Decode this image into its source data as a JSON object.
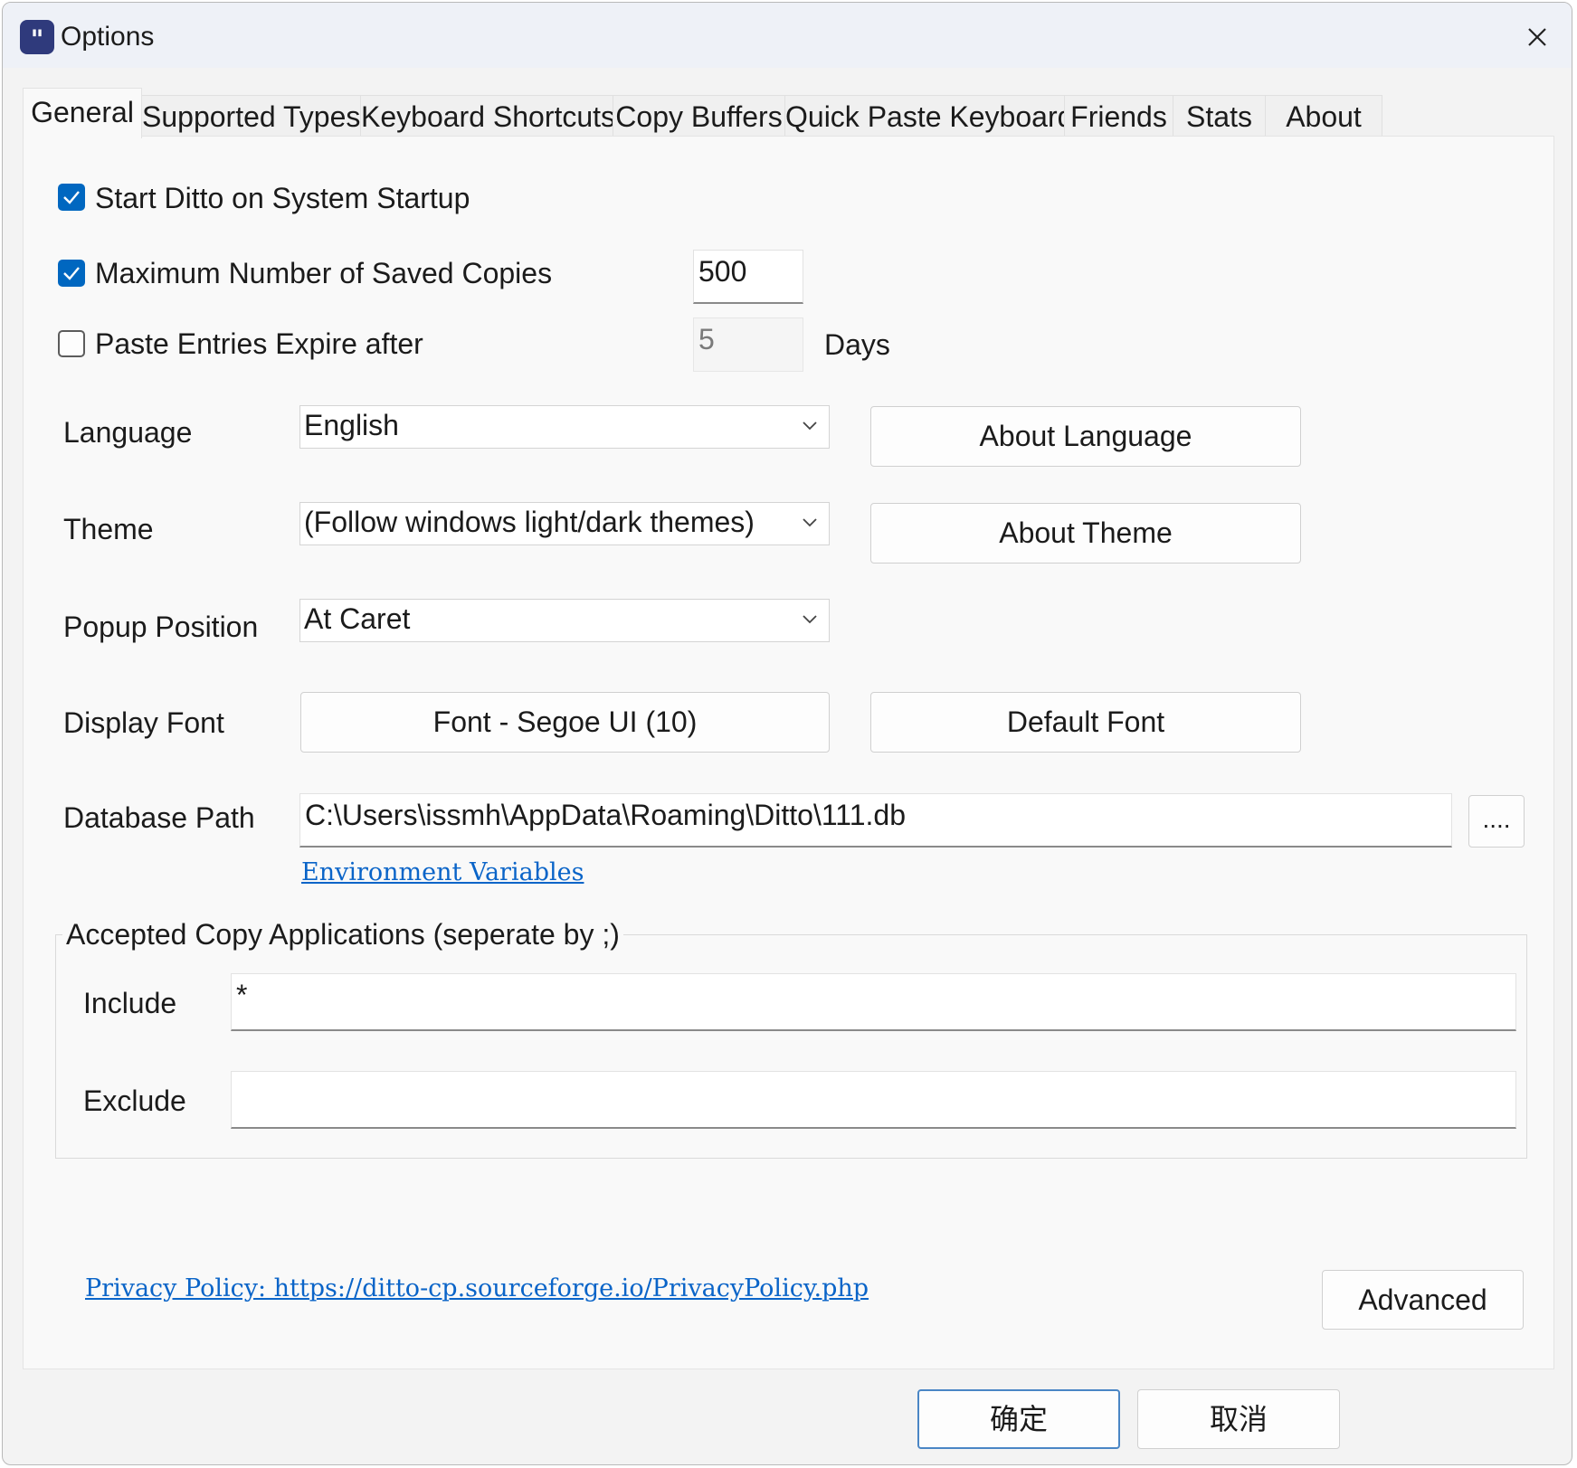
{
  "window": {
    "title": "Options",
    "app_icon_glyph": "\""
  },
  "tabs": [
    {
      "label": "General",
      "active": true
    },
    {
      "label": "Supported Types"
    },
    {
      "label": "Keyboard Shortcuts"
    },
    {
      "label": "Copy Buffers"
    },
    {
      "label": "Quick Paste Keyboard"
    },
    {
      "label": "Friends"
    },
    {
      "label": "Stats"
    },
    {
      "label": "About"
    }
  ],
  "general": {
    "start_on_startup": {
      "label": "Start Ditto on System Startup",
      "checked": true
    },
    "max_copies": {
      "label": "Maximum Number of Saved Copies",
      "checked": true,
      "value": "500"
    },
    "expire": {
      "label": "Paste Entries Expire after",
      "checked": false,
      "value": "5",
      "unit": "Days"
    },
    "language": {
      "label": "Language",
      "value": "English",
      "about_button": "About Language"
    },
    "theme": {
      "label": "Theme",
      "value": "(Follow windows light/dark themes)",
      "about_button": "About Theme"
    },
    "popup_position": {
      "label": "Popup Position",
      "value": "At Caret"
    },
    "display_font": {
      "label": "Display Font",
      "font_button": "Font - Segoe UI (10)",
      "default_button": "Default Font"
    },
    "database_path": {
      "label": "Database Path",
      "value": "C:\\Users\\issmh\\AppData\\Roaming\\Ditto\\111.db",
      "browse_button": "....",
      "env_link": "Environment Variables"
    },
    "accepted_apps": {
      "title": "Accepted Copy Applications (seperate by ;)",
      "include_label": "Include",
      "include_value": "*",
      "exclude_label": "Exclude",
      "exclude_value": ""
    },
    "privacy_link": "Privacy Policy: https://ditto-cp.sourceforge.io/PrivacyPolicy.php",
    "advanced_button": "Advanced"
  },
  "footer": {
    "ok_button": "确定",
    "cancel_button": "取消"
  },
  "colors": {
    "accent": "#0067c0",
    "link": "#0a64c8",
    "title_bar": "#eef1f7",
    "app_icon": "#2f3a7c"
  }
}
